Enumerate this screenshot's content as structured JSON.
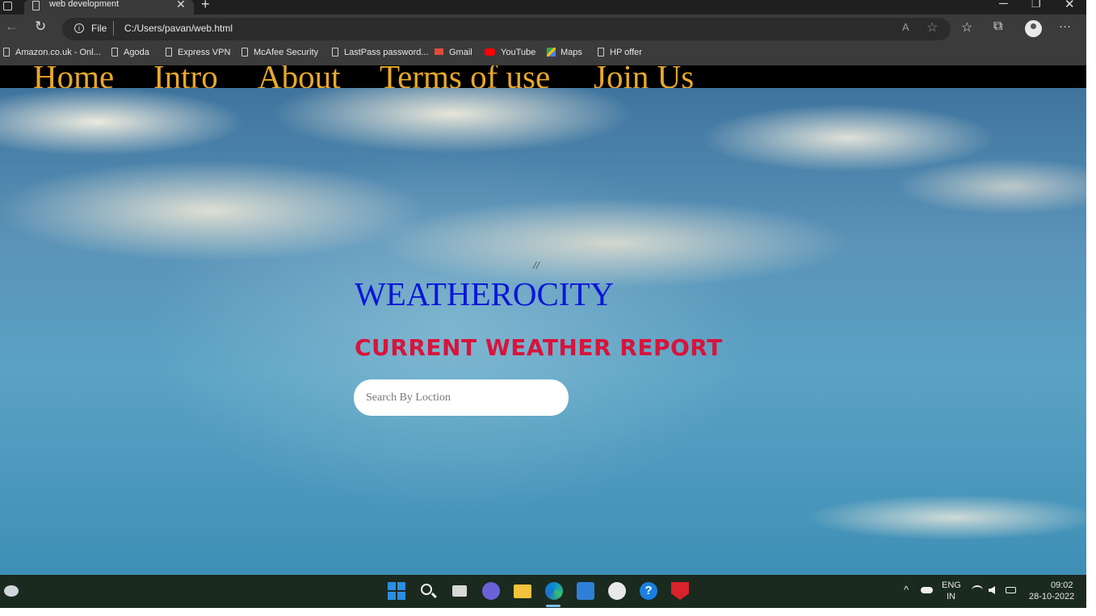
{
  "browser": {
    "tab_title": "web development",
    "tab_close": "✕",
    "new_tab": "+",
    "window_controls": {
      "minimize": "─",
      "restore": "❐",
      "close": "✕"
    },
    "address": {
      "scheme_label": "File",
      "info_glyph": "i",
      "url": "C:/Users/pavan/web.html"
    },
    "toolbar_icons": {
      "back": "←",
      "refresh": "↻",
      "read_aloud": "A",
      "favorite_add": "☆",
      "favorites": "☆",
      "collections": "⧉",
      "menu": "···"
    }
  },
  "bookmarks": [
    {
      "label": "Amazon.co.uk - Onl...",
      "icon": "page-icon"
    },
    {
      "label": "Agoda",
      "icon": "page-icon"
    },
    {
      "label": "Express VPN",
      "icon": "page-icon"
    },
    {
      "label": "McAfee Security",
      "icon": "page-icon"
    },
    {
      "label": "LastPass password...",
      "icon": "page-icon"
    },
    {
      "label": "Gmail",
      "icon": "gmail-icon"
    },
    {
      "label": "YouTube",
      "icon": "youtube-icon"
    },
    {
      "label": "Maps",
      "icon": "maps-icon"
    },
    {
      "label": "HP offer",
      "icon": "page-icon"
    }
  ],
  "site": {
    "nav": [
      "Home",
      "Intro",
      "About",
      "Terms of use",
      "Join Us"
    ],
    "stray_text": "//",
    "brand": "WEATHEROCITY",
    "heading": "CURRENT WEATHER REPORT",
    "search_placeholder": "Search By Loction",
    "colors": {
      "nav_text": "#e8a82a",
      "brand": "#0a16d8",
      "heading": "#d8143c"
    }
  },
  "taskbar": {
    "apps": [
      "start-icon",
      "search-icon",
      "task-view-icon",
      "chat-icon",
      "file-explorer-icon",
      "edge-icon",
      "store-icon",
      "app-icon",
      "help-icon",
      "mcafee-icon"
    ],
    "tray": {
      "chevron": "^",
      "lang_line1": "ENG",
      "lang_line2": "IN",
      "time": "09:02",
      "date": "28-10-2022"
    }
  }
}
